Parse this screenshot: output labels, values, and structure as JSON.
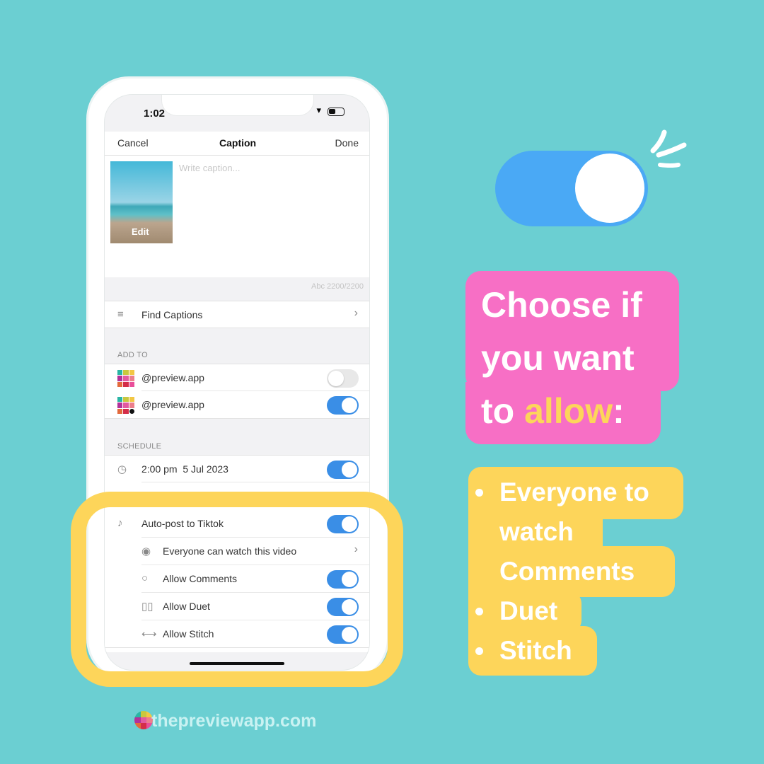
{
  "status_bar": {
    "time": "1:02"
  },
  "nav": {
    "cancel": "Cancel",
    "title": "Caption",
    "done": "Done"
  },
  "caption": {
    "placeholder": "Write caption...",
    "edit": "Edit",
    "count": "Abc 2200/2200"
  },
  "find_captions": {
    "label": "Find Captions",
    "icon": "lines-icon"
  },
  "add_to": {
    "header": "ADD TO",
    "accounts": [
      {
        "handle": "@preview.app",
        "platform": "instagram",
        "enabled": false
      },
      {
        "handle": "@preview.app",
        "platform": "tiktok",
        "enabled": true
      }
    ]
  },
  "schedule": {
    "header": "SCHEDULE",
    "datetime": "2:00 pm  5 Jul 2023",
    "enabled": true
  },
  "tiktok": {
    "autopost": {
      "label": "Auto-post to Tiktok",
      "enabled": true
    },
    "visibility": {
      "label": "Everyone can watch this video"
    },
    "comments": {
      "label": "Allow Comments",
      "enabled": true
    },
    "duet": {
      "label": "Allow Duet",
      "enabled": true
    },
    "stitch": {
      "label": "Allow Stitch",
      "enabled": true
    }
  },
  "headline": {
    "line1": "Choose if",
    "line2": "you want",
    "line3_prefix": "to ",
    "line3_highlight": "allow",
    "line3_suffix": ":"
  },
  "list": {
    "items": [
      "Everyone to",
      "watch",
      "Comments",
      "Duet",
      "Stitch"
    ]
  },
  "footer": {
    "logo_text": "thepreviewapp.com"
  },
  "colors": {
    "background": "#6bcfd2",
    "pink": "#f76fc5",
    "yellow": "#fdd55a",
    "toggle_blue": "#3a8ee6",
    "big_toggle": "#4aa9f5"
  }
}
